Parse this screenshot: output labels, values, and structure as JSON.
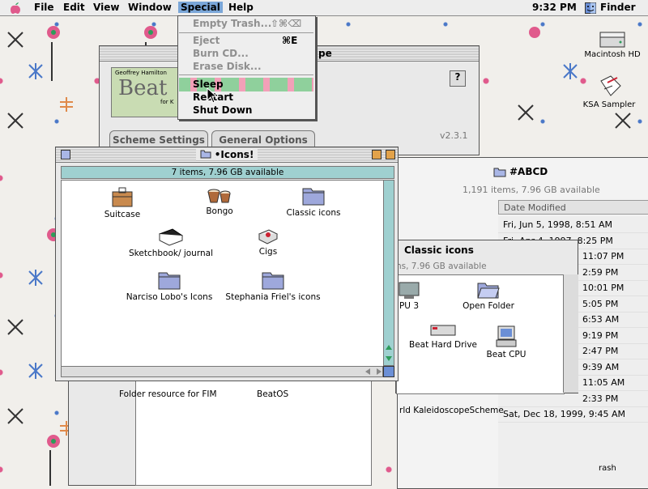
{
  "menubar": {
    "apple_icon": "apple-icon",
    "items": [
      "File",
      "Edit",
      "View",
      "Window",
      "Special",
      "Help"
    ],
    "clock": "9:32 PM",
    "app_name": "Finder"
  },
  "special_menu": {
    "items": [
      {
        "label": "Empty Trash...",
        "shortcut": "⇧⌘⌫",
        "disabled": true
      },
      {
        "label": "Eject",
        "shortcut": "⌘E",
        "disabled": true
      },
      {
        "label": "Burn CD...",
        "disabled": true
      },
      {
        "label": "Erase Disk...",
        "disabled": true
      },
      {
        "label": "Sleep",
        "highlighted": true
      },
      {
        "label": "Restart"
      },
      {
        "label": "Shut Down"
      }
    ]
  },
  "desktop_icons": [
    {
      "label": "Macintosh HD",
      "icon": "hard-drive-icon"
    },
    {
      "label": "KSA Sampler",
      "icon": "app-document-icon"
    }
  ],
  "beat_window": {
    "banner_line1": "Geoffrey Hamilton",
    "banner_big": "Beat",
    "banner_small": "for K",
    "title_fragment": "pe",
    "help_icon": "question-icon",
    "version": "v2.3.1",
    "tabs": [
      "Scheme Settings",
      "General Options"
    ]
  },
  "icons_window": {
    "title": "•Icons!",
    "status": "7 items, 7.96 GB available",
    "items": [
      {
        "label": "Suitcase",
        "icon": "suitcase-icon"
      },
      {
        "label": "Bongo",
        "icon": "bongo-icon"
      },
      {
        "label": "Classic icons",
        "icon": "folder-icon"
      },
      {
        "label": "Sketchbook/ journal",
        "icon": "sketchbook-icon"
      },
      {
        "label": "Cigs",
        "icon": "cigs-icon"
      },
      {
        "label": "Narciso Lobo's Icons",
        "icon": "folder-icon"
      },
      {
        "label": "Stephania Friel's icons",
        "icon": "folder-icon"
      }
    ]
  },
  "abcd_window": {
    "title": "#ABCD",
    "status": "1,191 items, 7.96 GB available",
    "col_date": "Date Modified",
    "dates": [
      "Fri, Jun 5, 1998, 8:51 AM",
      "Fri, Apr 4, 1997, 8:25 PM",
      "11:07 PM",
      "2:59 PM",
      "10:01 PM",
      "5:05 PM",
      "6:53 AM",
      "9:19 PM",
      "2:47 PM",
      "9:39 AM",
      "11:05 AM",
      "2:33 PM",
      "Sat, Dec 18, 1999, 9:45 AM"
    ],
    "row_name_fragment": "rld KaleidoscopeScheme",
    "bottom_fragment": "rash"
  },
  "classic_window": {
    "title": "Classic icons",
    "status_fragment": "ns, 7.96 GB available",
    "items": [
      {
        "label": "PU 3",
        "icon": "monitor-icon"
      },
      {
        "label": "Open Folder",
        "icon": "open-folder-icon"
      },
      {
        "label": "Beat Hard Drive",
        "icon": "hard-drive-icon"
      },
      {
        "label": "Beat CPU",
        "icon": "computer-icon"
      }
    ]
  },
  "back_folder_window": {
    "items": [
      "Folder resource for FIM",
      "BeatOS"
    ]
  }
}
